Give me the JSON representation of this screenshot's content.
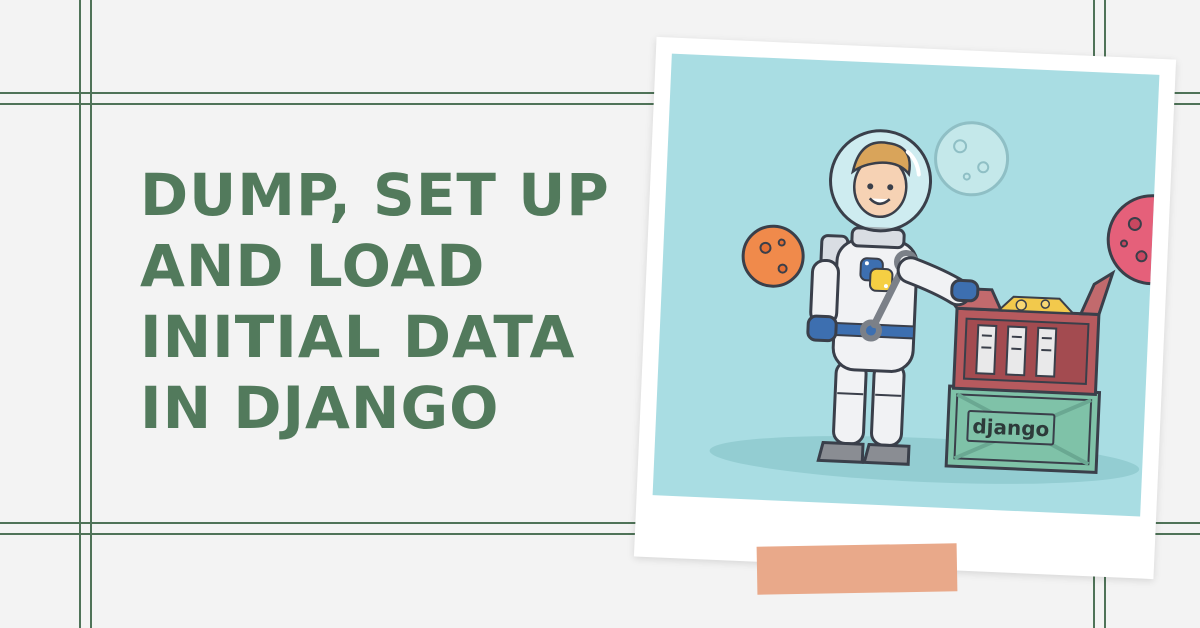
{
  "headline": {
    "lines": [
      "DUMP, SET UP",
      "AND LOAD",
      "INITIAL DATA",
      "IN DJANGO"
    ],
    "color": "#527a5c"
  },
  "illustration": {
    "crate_label": "django",
    "colors": {
      "background": "#a9dde3",
      "grid": "#4f7358",
      "tape": "#e9a98a",
      "planet_orange": "#f08a4b",
      "planet_pink": "#e5607a",
      "crate_red": "#b65a5e",
      "crate_green": "#7fc2a8"
    },
    "icons": [
      "astronaut",
      "python-logo",
      "wrench",
      "open-crate",
      "django-crate",
      "planet"
    ]
  }
}
